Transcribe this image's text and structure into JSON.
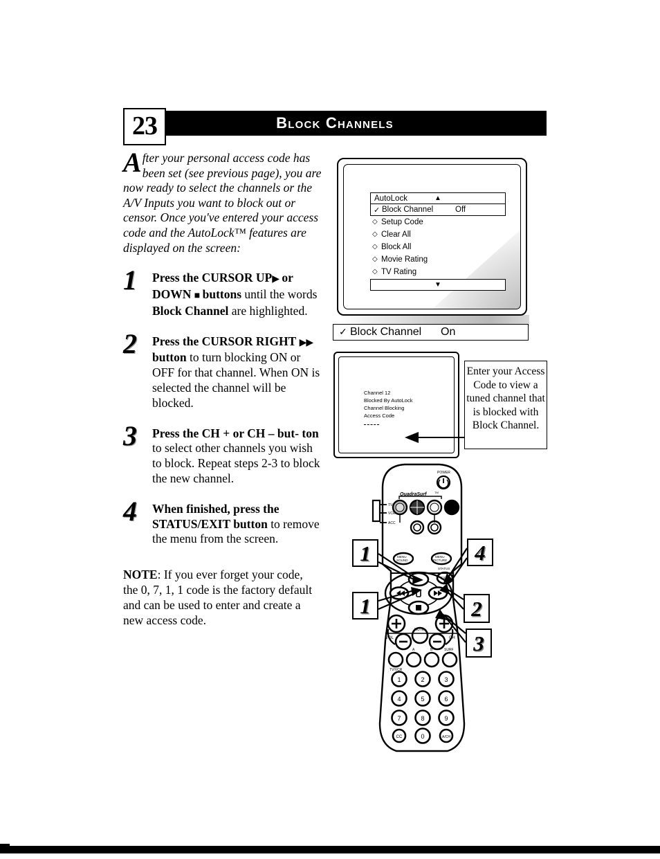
{
  "page": {
    "number": "23",
    "title": "Block Channels"
  },
  "intro": {
    "dropcap": "A",
    "text": "fter your personal access code has been set (see previous page), you are now ready to select the channels or the A/V Inputs you want to block out or censor. Once you've entered your access code and the AutoLock™ features are displayed on the screen:"
  },
  "steps": [
    {
      "number": "1",
      "bold_lead": "Press the CURSOR UP",
      "glyph1": "▶",
      "mid1": " or",
      "bold_lead2": "DOWN",
      "glyph2": "■",
      "bold_lead3": "buttons",
      "rest": " until the words ",
      "bold_emph": "Block Channel",
      "tail": " are highlighted."
    },
    {
      "number": "2",
      "bold_lead": "Press the CURSOR RIGHT",
      "glyph1": "▶▶",
      "bold_lead2": "button",
      "rest": " to turn blocking ON or OFF for that channel. When ON is selected the channel will be blocked."
    },
    {
      "number": "3",
      "bold_lead": "Press the CH + or CH – but-",
      "bold_lead2": "ton",
      "rest": " to select other channels you wish to block. Repeat steps 2-3 to block the new channel."
    },
    {
      "number": "4",
      "bold_lead": "When finished, press the",
      "bold_lead2": "STATUS/EXIT button",
      "rest": " to remove the menu from the screen."
    }
  ],
  "note": {
    "label": "NOTE",
    "text": ": If you ever forget your code, the 0, 7, 1, 1 code is the factory default and can be used to enter and create a new access code."
  },
  "osd_menu": {
    "scroll_top_label": "AutoLock",
    "scroll_up_arrow": "▲",
    "scroll_down_arrow": "▼",
    "highlighted": {
      "check": "✓",
      "name": "Block Channel",
      "value": "Off"
    },
    "items": [
      {
        "bullet": "◇",
        "label": "Setup Code"
      },
      {
        "bullet": "◇",
        "label": "Clear All"
      },
      {
        "bullet": "◇",
        "label": "Block All"
      },
      {
        "bullet": "◇",
        "label": "Movie Rating"
      },
      {
        "bullet": "◇",
        "label": "TV Rating"
      }
    ]
  },
  "on_bar": {
    "check": "✓",
    "name": "Block Channel",
    "value": "On"
  },
  "tv2_screen": {
    "line1": "Channel 12",
    "line2": "Blocked By AutoLock",
    "line3": "Channel Blocking",
    "line4": "Access Code",
    "dashes": "- - - -"
  },
  "callout": {
    "text": "Enter your Access Code to view a tuned channel that is blocked with Block Channel."
  },
  "callout_boxes": {
    "box_1a": "1",
    "box_1b": "1",
    "box_2": "2",
    "box_3": "3",
    "box_4": "4"
  },
  "remote": {
    "brand_text": "QuadraSurf",
    "brand_tm": "™",
    "power_label": "POWER",
    "side_labels": [
      "TV",
      "VCR",
      "ACC"
    ],
    "menu_sound_label": "MENU\nSOUND",
    "menu_picture_label": "MENU\nPICTURE",
    "status_label": "STATUS",
    "exit_label": "EXIT",
    "vol_label": "VOL",
    "ch_label": "CH",
    "mute_label": "MUTE",
    "a_label": "A",
    "b_label": "B",
    "surf_label": "SURF",
    "tvvcr_label": "TV/VCR",
    "keypad": [
      "1",
      "2",
      "3",
      "4",
      "5",
      "6",
      "7",
      "8",
      "9",
      "CC",
      "0",
      "A/CH"
    ],
    "plus": "+",
    "minus": "–"
  },
  "colors": {
    "ink": "#000000",
    "paper": "#ffffff"
  }
}
